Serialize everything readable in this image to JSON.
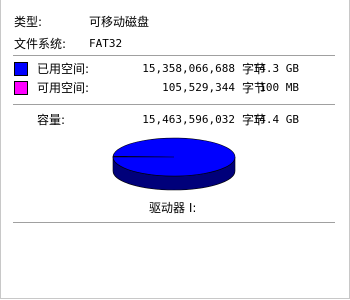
{
  "general": {
    "type_label": "类型:",
    "type_value": "可移动磁盘",
    "fs_label": "文件系统:",
    "fs_value": "FAT32"
  },
  "space": {
    "used": {
      "label": "已用空间:",
      "bytes": "15,358,066,688",
      "unit": "字节",
      "size": "14.3 GB",
      "color": "#0000ff"
    },
    "free": {
      "label": "可用空间:",
      "bytes": "105,529,344",
      "unit": "字节",
      "size": "100 MB",
      "color": "#ff00ff"
    },
    "capacity": {
      "label": "容量:",
      "bytes": "15,463,596,032",
      "unit": "字节",
      "size": "14.4 GB"
    }
  },
  "drive_label": "驱动器 I:",
  "chart_data": {
    "type": "pie",
    "categories": [
      "已用空间",
      "可用空间"
    ],
    "values": [
      15358066688,
      105529344
    ],
    "colors": [
      "#0000ff",
      "#ff00ff"
    ]
  }
}
